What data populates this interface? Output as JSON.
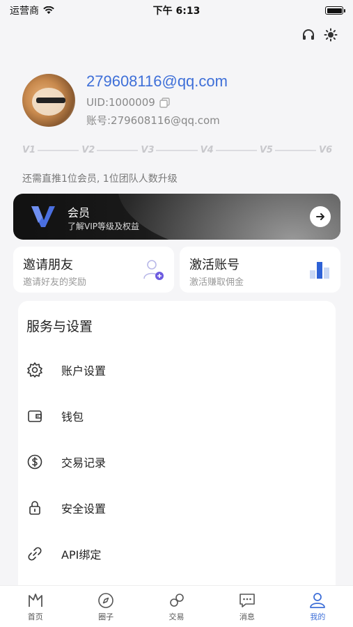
{
  "status_bar": {
    "carrier": "运营商",
    "time": "下午 6:13"
  },
  "profile": {
    "email": "279608116@qq.com",
    "uid": "UID:1000009",
    "account": "账号:279608116@qq.com"
  },
  "vip_levels": [
    "V1",
    "V2",
    "V3",
    "V4",
    "V5",
    "V6"
  ],
  "upgrade_hint": "还需直推1位会员, 1位团队人数升级",
  "vip_banner": {
    "title": "会员",
    "subtitle": "了解VIP等级及权益"
  },
  "cards": [
    {
      "title": "邀请朋友",
      "subtitle": "邀请好友的奖励"
    },
    {
      "title": "激活账号",
      "subtitle": "激活赚取佣金"
    }
  ],
  "services": {
    "title": "服务与设置",
    "items": [
      {
        "label": "账户设置",
        "icon": "gear-icon"
      },
      {
        "label": "钱包",
        "icon": "wallet-icon"
      },
      {
        "label": "交易记录",
        "icon": "dollar-icon"
      },
      {
        "label": "安全设置",
        "icon": "lock-icon"
      },
      {
        "label": "API绑定",
        "icon": "link-icon"
      }
    ]
  },
  "tabbar": [
    {
      "label": "首页",
      "icon": "home-icon"
    },
    {
      "label": "圈子",
      "icon": "compass-icon"
    },
    {
      "label": "交易",
      "icon": "trade-icon"
    },
    {
      "label": "消息",
      "icon": "message-icon"
    },
    {
      "label": "我的",
      "icon": "profile-icon",
      "active": true
    }
  ],
  "colors": {
    "accent": "#3e6fd8",
    "background": "#f5f5f7"
  }
}
